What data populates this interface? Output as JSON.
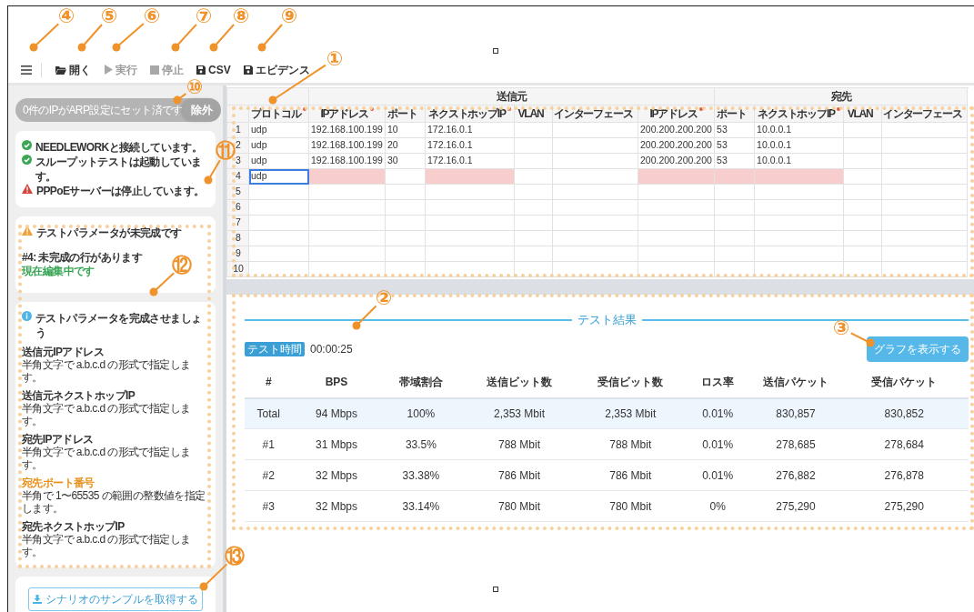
{
  "callouts": [
    {
      "label": "④"
    },
    {
      "label": "⑤"
    },
    {
      "label": "⑥"
    },
    {
      "label": "⑦"
    },
    {
      "label": "⑧"
    },
    {
      "label": "⑨"
    },
    {
      "label": "①"
    },
    {
      "label": "⑩"
    },
    {
      "label": "⑪"
    },
    {
      "label": "⑫"
    },
    {
      "label": "②"
    },
    {
      "label": "③"
    },
    {
      "label": "⑬"
    }
  ],
  "toolbar": {
    "items": [
      {
        "label": "開く",
        "disabled": false
      },
      {
        "label": "実行",
        "disabled": true
      },
      {
        "label": "停止",
        "disabled": true
      },
      {
        "label": "CSV",
        "disabled": false
      },
      {
        "label": "エビデンス",
        "disabled": false
      }
    ]
  },
  "sidebar": {
    "arp": {
      "text": "0件のIPがARP設定にセット済です",
      "button": "除外"
    },
    "status": [
      {
        "kind": "ok",
        "text": "NEEDLEWORKと接続しています。"
      },
      {
        "kind": "ok",
        "text": "スループットテストは起動しています。"
      },
      {
        "kind": "error",
        "text": "PPPoEサーバーは停止しています。"
      }
    ],
    "validation": {
      "title": "テストパラメータが未完成です",
      "row": "#4: 未完成の行があります",
      "editing": "現在編集中です"
    },
    "help": {
      "title": "テストパラメータを完成させましょう",
      "fields": [
        {
          "label": "送信元IPアドレス",
          "desc": "半角文字で a.b.c.d の形式で指定します。",
          "error": false
        },
        {
          "label": "送信元ネクストホップIP",
          "desc": "半角文字で a.b.c.d の形式で指定します。",
          "error": false
        },
        {
          "label": "宛先IPアドレス",
          "desc": "半角文字で a.b.c.d の形式で指定します。",
          "error": false
        },
        {
          "label": "宛先ポート番号",
          "desc": "半角で 1〜65535 の範囲の整数値を指定します。",
          "error": true
        },
        {
          "label": "宛先ネクストホップIP",
          "desc": "半角文字で a.b.c.d の形式で指定します。",
          "error": false
        }
      ]
    },
    "download": "シナリオのサンプルを取得する"
  },
  "grid": {
    "groups": [
      {
        "label": "送信元"
      },
      {
        "label": "宛先"
      }
    ],
    "columns": [
      {
        "label": "プロトコル",
        "required": true
      },
      {
        "label": "IPアドレス",
        "required": true
      },
      {
        "label": "ポート",
        "required": false
      },
      {
        "label": "ネクストホップIP",
        "required": true
      },
      {
        "label": "VLAN",
        "required": false
      },
      {
        "label": "インターフェース",
        "required": false
      },
      {
        "label": "IPアドレス",
        "required": true
      },
      {
        "label": "ポート",
        "required": false
      },
      {
        "label": "ネクストホップIP",
        "required": true
      },
      {
        "label": "VLAN",
        "required": false
      },
      {
        "label": "インターフェース",
        "required": false
      }
    ],
    "rows": [
      {
        "number": "1",
        "cells": [
          {
            "value": "udp",
            "invalid": false,
            "selected": false
          },
          {
            "value": "192.168.100.199",
            "invalid": false,
            "selected": false
          },
          {
            "value": "10",
            "invalid": false,
            "selected": false
          },
          {
            "value": "172.16.0.1",
            "invalid": false,
            "selected": false
          },
          {
            "invalid": false,
            "selected": false
          },
          {
            "invalid": false,
            "selected": false
          },
          {
            "value": "200.200.200.200",
            "invalid": false,
            "selected": false
          },
          {
            "value": "53",
            "invalid": false,
            "selected": false
          },
          {
            "value": "10.0.0.1",
            "invalid": false,
            "selected": false
          },
          {
            "invalid": false,
            "selected": false
          },
          {
            "invalid": false,
            "selected": false
          }
        ]
      },
      {
        "number": "2",
        "cells": [
          {
            "value": "udp",
            "invalid": false,
            "selected": false
          },
          {
            "value": "192.168.100.199",
            "invalid": false,
            "selected": false
          },
          {
            "value": "20",
            "invalid": false,
            "selected": false
          },
          {
            "value": "172.16.0.1",
            "invalid": false,
            "selected": false
          },
          {
            "invalid": false,
            "selected": false
          },
          {
            "invalid": false,
            "selected": false
          },
          {
            "value": "200.200.200.200",
            "invalid": false,
            "selected": false
          },
          {
            "value": "53",
            "invalid": false,
            "selected": false
          },
          {
            "value": "10.0.0.1",
            "invalid": false,
            "selected": false
          },
          {
            "invalid": false,
            "selected": false
          },
          {
            "invalid": false,
            "selected": false
          }
        ]
      },
      {
        "number": "3",
        "cells": [
          {
            "value": "udp",
            "invalid": false,
            "selected": false
          },
          {
            "value": "192.168.100.199",
            "invalid": false,
            "selected": false
          },
          {
            "value": "30",
            "invalid": false,
            "selected": false
          },
          {
            "value": "172.16.0.1",
            "invalid": false,
            "selected": false
          },
          {
            "invalid": false,
            "selected": false
          },
          {
            "invalid": false,
            "selected": false
          },
          {
            "value": "200.200.200.200",
            "invalid": false,
            "selected": false
          },
          {
            "value": "53",
            "invalid": false,
            "selected": false
          },
          {
            "value": "10.0.0.1",
            "invalid": false,
            "selected": false
          },
          {
            "invalid": false,
            "selected": false
          },
          {
            "invalid": false,
            "selected": false
          }
        ]
      },
      {
        "number": "4",
        "cells": [
          {
            "value": "udp",
            "invalid": false,
            "selected": true
          },
          {
            "invalid": true,
            "selected": false
          },
          {
            "invalid": false,
            "selected": false
          },
          {
            "invalid": true,
            "selected": false
          },
          {
            "invalid": false,
            "selected": false
          },
          {
            "invalid": false,
            "selected": false
          },
          {
            "invalid": true,
            "selected": false
          },
          {
            "invalid": true,
            "selected": false
          },
          {
            "invalid": true,
            "selected": false
          },
          {
            "invalid": false,
            "selected": false
          },
          {
            "invalid": false,
            "selected": false
          }
        ]
      },
      {
        "number": "5"
      },
      {
        "number": "6"
      },
      {
        "number": "7"
      },
      {
        "number": "8"
      },
      {
        "number": "9"
      },
      {
        "number": "10"
      }
    ]
  },
  "results": {
    "legend": "テスト結果",
    "timer_badge": "テスト時間",
    "timer": "00:00:25",
    "graph_button": "グラフを表示する",
    "columns": [
      "#",
      "BPS",
      "帯域割合",
      "送信ビット数",
      "受信ビット数",
      "ロス率",
      "送信パケット",
      "受信パケット"
    ],
    "rows": [
      {
        "selected": true,
        "cells": [
          "Total",
          "94 Mbps",
          "100%",
          "2,353 Mbit",
          "2,353 Mbit",
          "0.01%",
          "830,857",
          "830,852"
        ]
      },
      {
        "selected": false,
        "cells": [
          "#1",
          "31 Mbps",
          "33.5%",
          "788 Mbit",
          "788 Mbit",
          "0.01%",
          "278,685",
          "278,684"
        ]
      },
      {
        "selected": false,
        "cells": [
          "#2",
          "32 Mbps",
          "33.38%",
          "786 Mbit",
          "786 Mbit",
          "0.01%",
          "276,882",
          "276,878"
        ]
      },
      {
        "selected": false,
        "cells": [
          "#3",
          "32 Mbps",
          "33.14%",
          "780 Mbit",
          "780 Mbit",
          "0%",
          "275,290",
          "275,290"
        ]
      }
    ]
  }
}
